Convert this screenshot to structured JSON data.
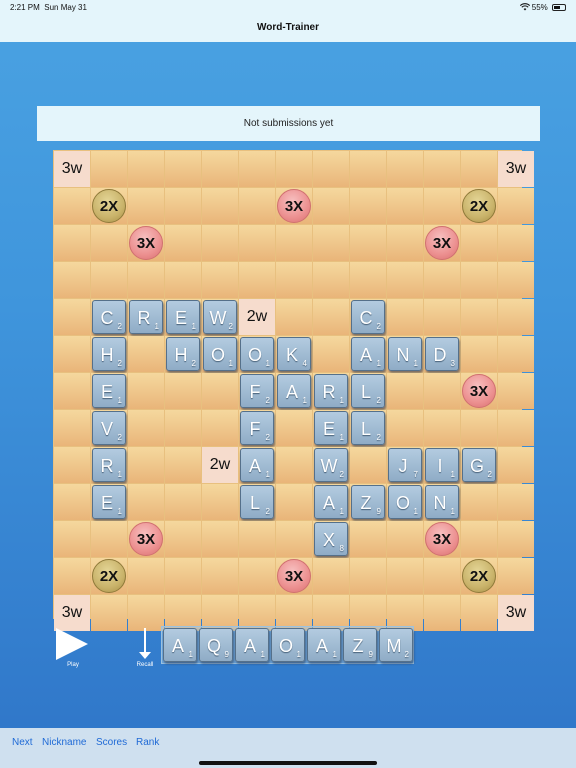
{
  "status_bar": {
    "time": "2:21 PM",
    "date": "Sun May 31",
    "wifi_icon": "wifi-icon",
    "battery": "55%",
    "battery_icon": "battery-icon"
  },
  "nav": {
    "title": "Word-Trainer"
  },
  "banner": {
    "text": "Not submissions yet"
  },
  "colors": {
    "tile": "#9fbad3",
    "triple": "#ec9090",
    "double": "#c9b36a",
    "word_cell": "#f6dccd",
    "board": "#e9b579",
    "link": "#1f6ad6"
  },
  "board": {
    "size": 13,
    "premiums": [
      {
        "row": 0,
        "col": 0,
        "label": "3w",
        "style": "word"
      },
      {
        "row": 0,
        "col": 12,
        "label": "3w",
        "style": "word"
      },
      {
        "row": 1,
        "col": 1,
        "label": "2X",
        "style": "gold"
      },
      {
        "row": 1,
        "col": 6,
        "label": "3X",
        "style": "red"
      },
      {
        "row": 1,
        "col": 11,
        "label": "2X",
        "style": "gold"
      },
      {
        "row": 2,
        "col": 2,
        "label": "3X",
        "style": "red"
      },
      {
        "row": 2,
        "col": 10,
        "label": "3X",
        "style": "red"
      },
      {
        "row": 4,
        "col": 5,
        "label": "2w",
        "style": "word"
      },
      {
        "row": 6,
        "col": 1,
        "label": "",
        "style": "red"
      },
      {
        "row": 6,
        "col": 11,
        "label": "3X",
        "style": "red"
      },
      {
        "row": 8,
        "col": 4,
        "label": "2w",
        "style": "word"
      },
      {
        "row": 10,
        "col": 2,
        "label": "3X",
        "style": "red"
      },
      {
        "row": 10,
        "col": 10,
        "label": "3X",
        "style": "red"
      },
      {
        "row": 11,
        "col": 1,
        "label": "2X",
        "style": "gold"
      },
      {
        "row": 11,
        "col": 6,
        "label": "3X",
        "style": "red"
      },
      {
        "row": 11,
        "col": 11,
        "label": "2X",
        "style": "gold"
      },
      {
        "row": 12,
        "col": 0,
        "label": "3w",
        "style": "word"
      },
      {
        "row": 12,
        "col": 12,
        "label": "3w",
        "style": "word"
      }
    ],
    "tiles": [
      {
        "row": 4,
        "col": 1,
        "letter": "C",
        "score": "2"
      },
      {
        "row": 4,
        "col": 2,
        "letter": "R",
        "score": "1"
      },
      {
        "row": 4,
        "col": 3,
        "letter": "E",
        "score": "1"
      },
      {
        "row": 4,
        "col": 4,
        "letter": "W",
        "score": "2"
      },
      {
        "row": 4,
        "col": 8,
        "letter": "C",
        "score": "2"
      },
      {
        "row": 5,
        "col": 1,
        "letter": "H",
        "score": "2"
      },
      {
        "row": 5,
        "col": 3,
        "letter": "H",
        "score": "2"
      },
      {
        "row": 5,
        "col": 4,
        "letter": "O",
        "score": "1"
      },
      {
        "row": 5,
        "col": 5,
        "letter": "O",
        "score": "1"
      },
      {
        "row": 5,
        "col": 6,
        "letter": "K",
        "score": "4"
      },
      {
        "row": 5,
        "col": 8,
        "letter": "A",
        "score": "1"
      },
      {
        "row": 5,
        "col": 9,
        "letter": "N",
        "score": "1"
      },
      {
        "row": 5,
        "col": 10,
        "letter": "D",
        "score": "3"
      },
      {
        "row": 6,
        "col": 1,
        "letter": "E",
        "score": "1"
      },
      {
        "row": 6,
        "col": 5,
        "letter": "F",
        "score": "2"
      },
      {
        "row": 6,
        "col": 6,
        "letter": "A",
        "score": "1"
      },
      {
        "row": 6,
        "col": 7,
        "letter": "R",
        "score": "1"
      },
      {
        "row": 6,
        "col": 8,
        "letter": "L",
        "score": "2"
      },
      {
        "row": 7,
        "col": 1,
        "letter": "V",
        "score": "2"
      },
      {
        "row": 7,
        "col": 5,
        "letter": "F",
        "score": "2"
      },
      {
        "row": 7,
        "col": 7,
        "letter": "E",
        "score": "1"
      },
      {
        "row": 7,
        "col": 8,
        "letter": "L",
        "score": "2"
      },
      {
        "row": 8,
        "col": 1,
        "letter": "R",
        "score": "1"
      },
      {
        "row": 8,
        "col": 5,
        "letter": "A",
        "score": "1"
      },
      {
        "row": 8,
        "col": 7,
        "letter": "W",
        "score": "2"
      },
      {
        "row": 8,
        "col": 9,
        "letter": "J",
        "score": "7"
      },
      {
        "row": 8,
        "col": 10,
        "letter": "I",
        "score": "1"
      },
      {
        "row": 8,
        "col": 11,
        "letter": "G",
        "score": "2"
      },
      {
        "row": 9,
        "col": 1,
        "letter": "E",
        "score": "1"
      },
      {
        "row": 9,
        "col": 5,
        "letter": "L",
        "score": "2"
      },
      {
        "row": 9,
        "col": 7,
        "letter": "A",
        "score": "1"
      },
      {
        "row": 9,
        "col": 8,
        "letter": "Z",
        "score": "9"
      },
      {
        "row": 9,
        "col": 9,
        "letter": "O",
        "score": "1"
      },
      {
        "row": 9,
        "col": 10,
        "letter": "N",
        "score": "1"
      },
      {
        "row": 10,
        "col": 7,
        "letter": "X",
        "score": "8"
      }
    ]
  },
  "controls": {
    "play_label": "Play",
    "play_icon": "play-icon",
    "recall_label": "Recall",
    "recall_icon": "arrow-down-icon"
  },
  "rack": [
    {
      "letter": "A",
      "score": "1"
    },
    {
      "letter": "Q",
      "score": "9"
    },
    {
      "letter": "A",
      "score": "1"
    },
    {
      "letter": "O",
      "score": "1"
    },
    {
      "letter": "A",
      "score": "1"
    },
    {
      "letter": "Z",
      "score": "9"
    },
    {
      "letter": "M",
      "score": "2"
    }
  ],
  "bottom_nav": {
    "next": "Next",
    "nickname": "Nickname",
    "scores": "Scores",
    "rank": "Rank"
  }
}
